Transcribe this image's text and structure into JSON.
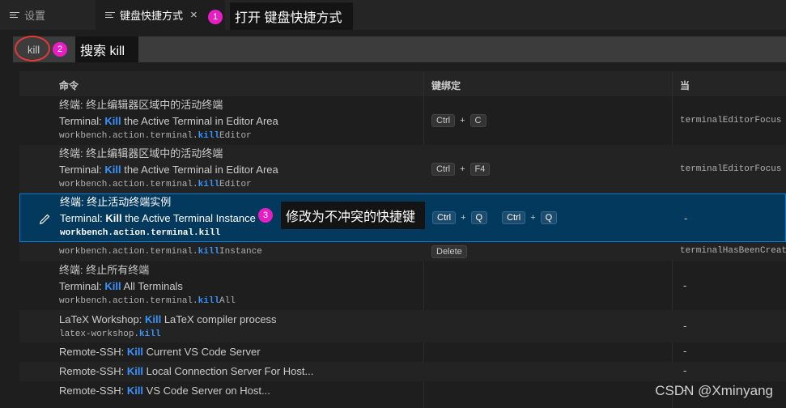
{
  "tabs": {
    "settings_label": "设置",
    "active_label": "键盘快捷方式",
    "close_symbol": "×"
  },
  "annotations": [
    {
      "num": "1",
      "text": "打开 键盘快捷方式"
    },
    {
      "num": "2",
      "text": "搜索 kill"
    },
    {
      "num": "3",
      "text": "修改为不冲突的快捷键"
    }
  ],
  "search": {
    "value": "kill"
  },
  "columns": {
    "command": "命令",
    "keybinding": "键绑定",
    "when": "当"
  },
  "rows": [
    {
      "l1": "终端: 终止编辑器区域中的活动终端",
      "l2_pre": "Terminal: ",
      "l2_hl": "Kill",
      "l2_post": " the Active Terminal in Editor Area",
      "l3_pre": "workbench.action.terminal.",
      "l3_hl": "kill",
      "l3_post": "Editor",
      "k1": "Ctrl",
      "k2": "C",
      "when": "terminalEditorFocus &"
    },
    {
      "l1": "终端: 终止编辑器区域中的活动终端",
      "l2_pre": "Terminal: ",
      "l2_hl": "Kill",
      "l2_post": " the Active Terminal in Editor Area",
      "l3_pre": "workbench.action.terminal.",
      "l3_hl": "kill",
      "l3_post": "Editor",
      "k1": "Ctrl",
      "k2": "F4",
      "when": "terminalEditorFocus &"
    },
    {
      "l1": "终端: 终止活动终端实例",
      "l2_pre": "Terminal: ",
      "l2_hl": "Kill",
      "l2_post": " the Active Terminal Instance",
      "l3_pre": "workbench.action.terminal.",
      "l3_hl": "kill",
      "l3_post": "",
      "k1": "Ctrl",
      "k2": "Q",
      "k3": "Ctrl",
      "k4": "Q",
      "when": "-"
    },
    {
      "l3_pre": "workbench.action.terminal.",
      "l3_hl": "kill",
      "l3_post": "Instance",
      "k1": "Delete",
      "when": "terminalHasBeenCreate"
    },
    {
      "l1": "终端: 终止所有终端",
      "l2_pre": "Terminal: ",
      "l2_hl": "Kill",
      "l2_post": " All Terminals",
      "l3_pre": "workbench.action.terminal.",
      "l3_hl": "kill",
      "l3_post": "All",
      "when": "-"
    },
    {
      "l2_pre": "LaTeX Workshop: ",
      "l2_hl": "Kill",
      "l2_post": " LaTeX compiler process",
      "l3_pre": "latex-workshop.",
      "l3_hl": "kill",
      "l3_post": "",
      "when": "-"
    },
    {
      "l2_pre": "Remote-SSH: ",
      "l2_hl": "Kill",
      "l2_post": " Current VS Code Server",
      "when": "-"
    },
    {
      "l2_pre": "Remote-SSH: ",
      "l2_hl": "Kill",
      "l2_post": " Local Connection Server For Host...",
      "when": "-"
    },
    {
      "l2_pre": "Remote-SSH: ",
      "l2_hl": "Kill",
      "l2_post": " VS Code Server on Host...",
      "when": "-"
    }
  ],
  "watermark": "CSDN @Xminyang",
  "colors": {
    "accent": "#3794ff",
    "marker": "#e81ec5",
    "selection": "#04395e",
    "circle": "#e53935"
  }
}
